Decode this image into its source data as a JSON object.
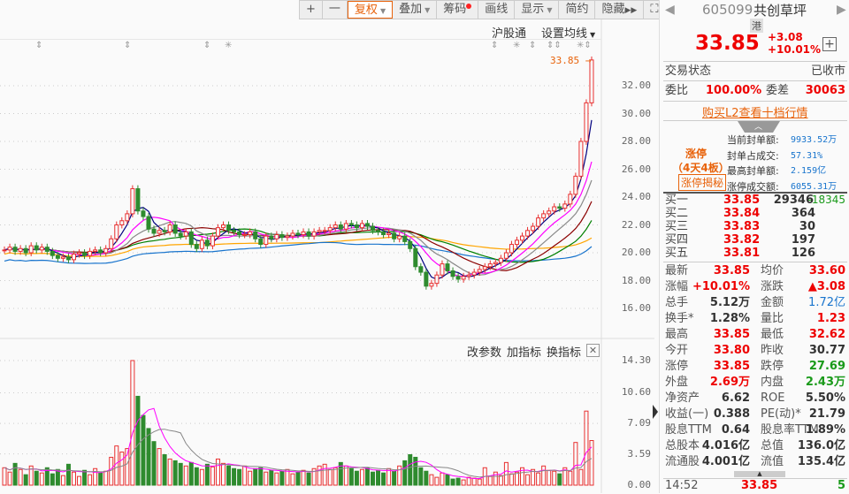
{
  "toolbar": {
    "items": [
      "+",
      "一",
      "复权",
      "叠加",
      "筹码",
      "画线",
      "显示",
      "简约",
      "隐藏"
    ],
    "fullscreen_icon": "expand-icon"
  },
  "chart_header": {
    "hk_connect": "沪股通",
    "ma_setting": "设置均线"
  },
  "price_label": "33.85",
  "price_axis": [
    "32.00",
    "30.00",
    "28.00",
    "26.00",
    "24.00",
    "22.00",
    "20.00",
    "18.00",
    "16.00"
  ],
  "price_ticks": [
    32,
    30,
    28,
    26,
    24,
    22,
    20,
    18,
    16
  ],
  "volume_header": {
    "change_params": "改参数",
    "add_indicator": "加指标",
    "switch_indicator": "换指标"
  },
  "volume_axis": [
    "14.30",
    "10.60",
    "7.09",
    "3.59",
    "0.00"
  ],
  "volume_ticks": [
    14.3,
    10.6,
    7.09,
    3.59,
    0
  ],
  "colors": {
    "up": "#e83030",
    "down": "#2e8b2e",
    "ma5": "#000080",
    "ma10": "#ff00ff",
    "ma20": "#888888",
    "ma30": "#8b0000",
    "ma60": "#008000",
    "ma120": "#1874cd",
    "ma250": "#ffa500"
  },
  "chart_data": {
    "type": "candlestick",
    "close": [
      20.2,
      20.4,
      20.1,
      20.3,
      20.0,
      20.5,
      20.2,
      20.4,
      20.1,
      19.8,
      19.6,
      19.7,
      19.5,
      19.9,
      20.0,
      19.8,
      20.1,
      20.2,
      20.0,
      20.3,
      21.0,
      22.0,
      22.3,
      22.8,
      24.6,
      23.0,
      22.6,
      21.7,
      21.4,
      21.6,
      21.5,
      22.0,
      21.4,
      21.2,
      21.5,
      20.6,
      20.3,
      20.9,
      20.5,
      21.2,
      21.8,
      22.0,
      21.6,
      21.5,
      21.3,
      21.3,
      21.5,
      21.0,
      20.6,
      21.2,
      21.0,
      21.3,
      21.1,
      21.2,
      21.4,
      21.3,
      21.5,
      21.2,
      21.5,
      21.6,
      21.6,
      21.8,
      22.0,
      21.7,
      22.1,
      22.0,
      21.8,
      22.1,
      21.9,
      21.6,
      21.5,
      21.3,
      21.4,
      21.0,
      21.2,
      20.8,
      20.3,
      19.0,
      18.6,
      17.6,
      17.8,
      18.4,
      19.2,
      18.7,
      18.3,
      18.1,
      18.3,
      18.4,
      18.6,
      18.8,
      19.0,
      19.2,
      19.3,
      19.6,
      20.0,
      20.6,
      20.9,
      21.2,
      21.6,
      21.9,
      22.5,
      22.8,
      23.0,
      23.3,
      23.2,
      23.5,
      24.2,
      25.5,
      28.0,
      30.77,
      33.85
    ],
    "volume": [
      2.0,
      1.5,
      2.5,
      1.8,
      1.2,
      2.2,
      1.6,
      1.4,
      2.0,
      1.3,
      1.8,
      1.1,
      2.4,
      1.5,
      1.0,
      1.7,
      1.2,
      1.9,
      1.4,
      1.6,
      3.2,
      4.5,
      3.8,
      4.2,
      14.3,
      10.2,
      8.0,
      6.5,
      5.0,
      4.2,
      3.5,
      3.0,
      2.8,
      2.5,
      2.2,
      2.6,
      2.0,
      1.8,
      2.4,
      2.1,
      3.0,
      2.5,
      2.2,
      1.9,
      1.8,
      2.2,
      1.6,
      1.9,
      2.0,
      1.5,
      1.7,
      1.4,
      1.6,
      1.8,
      1.3,
      1.5,
      1.7,
      1.4,
      1.9,
      2.2,
      2.4,
      1.8,
      2.0,
      2.6,
      2.2,
      1.9,
      1.6,
      1.8,
      2.0,
      1.5,
      1.7,
      1.4,
      1.9,
      1.6,
      2.2,
      2.8,
      3.5,
      3.2,
      2.0,
      1.6,
      1.2,
      0.9,
      1.4,
      1.2,
      0.7,
      0.8,
      0.6,
      0.9,
      0.8,
      0.7,
      2.0,
      1.0,
      1.5,
      1.1,
      2.6,
      1.3,
      1.5,
      2.0,
      1.2,
      1.8,
      1.4,
      2.2,
      1.7,
      1.6,
      1.3,
      2.0,
      1.6,
      4.9,
      1.8,
      8.5,
      5.12
    ],
    "ylim": [
      15,
      34
    ],
    "volume_ylim": [
      0,
      14.3
    ],
    "grid": true
  },
  "quote": {
    "code": "605099",
    "name": "共创草坪",
    "tag": "港",
    "price": "33.85",
    "change": "+3.08",
    "change_pct": "+10.01%"
  },
  "status": {
    "label": "交易状态",
    "value": "已收市"
  },
  "weibi": {
    "label": "委比",
    "value": "100.00%",
    "diff_label": "委差",
    "diff_value": "30063"
  },
  "l2_link": "购买L2查看十档行情",
  "limit": {
    "title": "涨停",
    "streak": "（4天4板）",
    "reveal": "涨停揭秘",
    "rows": [
      {
        "k": "当前封单额:",
        "v": "9933.52万"
      },
      {
        "k": "封单占成交:",
        "v": "57.31%"
      },
      {
        "k": "最高封单额:",
        "v": "2.159亿"
      },
      {
        "k": "涨停成交额:",
        "v": "6055.31万"
      }
    ]
  },
  "bids": [
    {
      "label": "买一",
      "price": "33.85",
      "vol": "29346",
      "chg": "-18345"
    },
    {
      "label": "买二",
      "price": "33.84",
      "vol": "364"
    },
    {
      "label": "买三",
      "price": "33.83",
      "vol": "30"
    },
    {
      "label": "买四",
      "price": "33.82",
      "vol": "197"
    },
    {
      "label": "买五",
      "price": "33.81",
      "vol": "126"
    }
  ],
  "stats": [
    {
      "k1": "最新",
      "v1": "33.85",
      "c1": "red",
      "k2": "均价",
      "v2": "33.60",
      "c2": "red"
    },
    {
      "k1": "涨幅",
      "v1": "+10.01%",
      "c1": "red",
      "k2": "涨跌",
      "v2": "▲3.08",
      "c2": "red"
    },
    {
      "k1": "总手",
      "v1": "5.12万",
      "c1": "gray",
      "k2": "金额",
      "v2": "1.72亿",
      "c2": "blue"
    },
    {
      "k1": "换手*",
      "v1": "1.28%",
      "c1": "gray",
      "k2": "量比",
      "v2": "1.23",
      "c2": "red"
    },
    {
      "k1": "最高",
      "v1": "33.85",
      "c1": "red",
      "k2": "最低",
      "v2": "32.62",
      "c2": "red"
    },
    {
      "k1": "今开",
      "v1": "33.80",
      "c1": "red",
      "k2": "昨收",
      "v2": "30.77",
      "c2": "gray"
    },
    {
      "k1": "涨停",
      "v1": "33.85",
      "c1": "red",
      "k2": "跌停",
      "v2": "27.69",
      "c2": "green"
    },
    {
      "k1": "外盘",
      "v1": "2.69万",
      "c1": "red",
      "k2": "内盘",
      "v2": "2.43万",
      "c2": "green"
    },
    {
      "k1": "净资产",
      "v1": "6.62",
      "c1": "gray",
      "k2": "ROE",
      "v2": "5.50%",
      "c2": "gray"
    },
    {
      "k1": "收益(一)",
      "v1": "0.388",
      "c1": "gray",
      "k2": "PE(动)*",
      "v2": "21.79",
      "c2": "gray"
    },
    {
      "k1": "股息TTM",
      "v1": "0.64",
      "c1": "gray",
      "k2": "股息率TTM",
      "v2": "1.89%",
      "c2": "gray"
    },
    {
      "k1": "总股本",
      "v1": "4.016亿",
      "c1": "gray",
      "k2": "总值",
      "v2": "136.0亿",
      "c2": "gray"
    },
    {
      "k1": "流通股",
      "v1": "4.001亿",
      "c1": "gray",
      "k2": "流值",
      "v2": "135.4亿",
      "c2": "gray"
    }
  ],
  "tick": {
    "time": "14:52",
    "price": "33.85",
    "vol": "5"
  }
}
